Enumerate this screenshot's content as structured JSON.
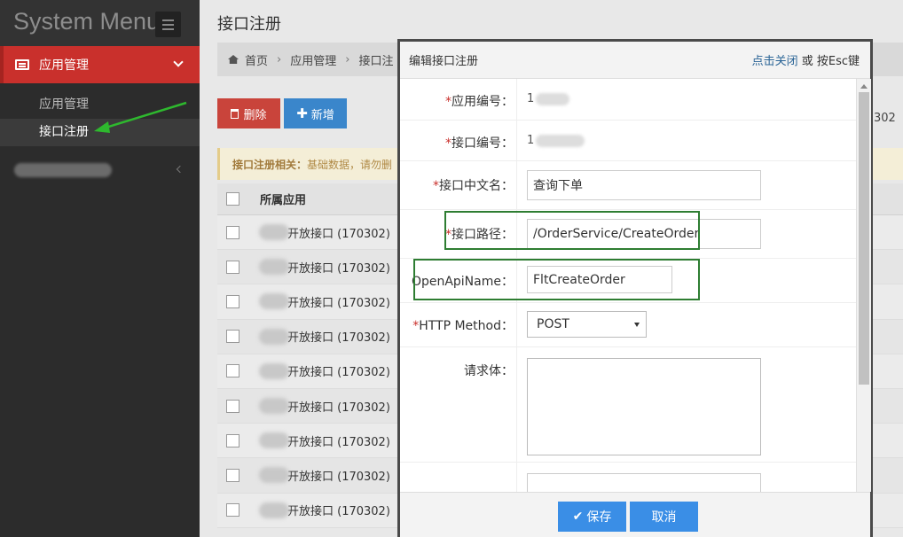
{
  "sidebar": {
    "title": "System Menu",
    "active_menu": "应用管理",
    "sub_items": [
      "应用管理",
      "接口注册"
    ]
  },
  "page": {
    "title": "接口注册"
  },
  "breadcrumb": {
    "items": [
      "首页",
      "应用管理",
      "接口注"
    ]
  },
  "toolbar": {
    "delete_label": "删除",
    "add_label": "新增",
    "count_text": "302"
  },
  "notice": {
    "label": "接口注册相关：",
    "text": "基础数据，请勿删"
  },
  "table": {
    "header": "所属应用",
    "rows": [
      "开放接口 (170302)",
      "开放接口 (170302)",
      "开放接口 (170302)",
      "开放接口 (170302)",
      "开放接口 (170302)",
      "开放接口 (170302)",
      "开放接口 (170302)",
      "开放接口 (170302)",
      "开放接口 (170302)"
    ]
  },
  "modal": {
    "title": "编辑接口注册",
    "close_link": "点击关闭",
    "close_suffix": " 或 按Esc键",
    "fields": {
      "app_no_label": "应用编号：",
      "app_no_value": "1",
      "api_no_label": "接口编号：",
      "api_no_value": "1",
      "cn_name_label": "接口中文名：",
      "cn_name_value": "查询下单",
      "path_label": "接口路径：",
      "path_value": "/OrderService/CreateOrder",
      "openapi_label": "OpenApiName：",
      "openapi_value": "FltCreateOrder",
      "method_label": "HTTP Method：",
      "method_value": "POST",
      "body_label": "请求体："
    },
    "save_label": "保存",
    "cancel_label": "取消"
  },
  "colors": {
    "sidebar_bg": "#2c2c2c",
    "active_menu": "#c9302c",
    "primary_button": "#3a8ee6",
    "delete_button": "#c9443b",
    "highlight_box": "#2e7d32",
    "annotation_arrow": "#2eb82e"
  }
}
